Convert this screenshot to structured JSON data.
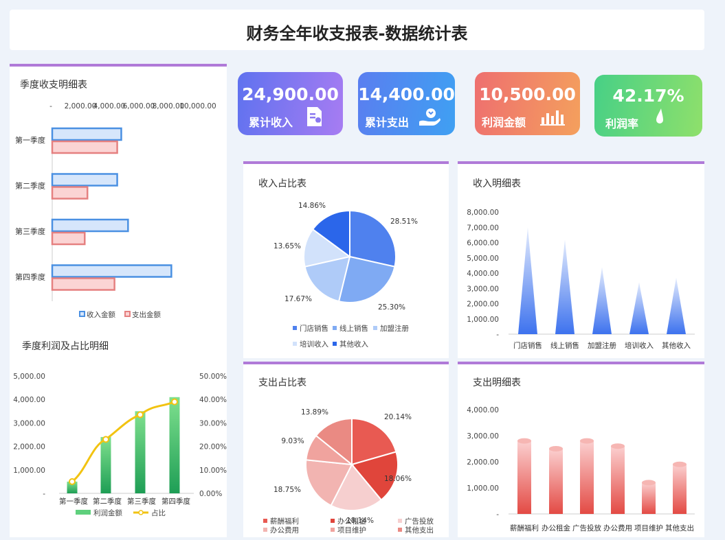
{
  "header": {
    "title": "财务全年收支报表-数据统计表"
  },
  "kpis": [
    {
      "value": "24,900.00",
      "label": "累计收入",
      "icon": "invoice-icon"
    },
    {
      "value": "14,400.00",
      "label": "累计支出",
      "icon": "hand-coin-icon"
    },
    {
      "value": "10,500.00",
      "label": "利润金额",
      "icon": "bar-chart-icon"
    },
    {
      "value": "42.17%",
      "label": "利润率",
      "icon": "drop-icon"
    }
  ],
  "colors": {
    "income": "#4a90e2",
    "income_fill": "#d6e6fb",
    "expense": "#e58080",
    "expense_fill": "#fbd4d4",
    "accent": "#b07ad8"
  },
  "chart_data": [
    {
      "id": "quarter",
      "type": "bar",
      "title": "季度收支明细表",
      "orientation": "horizontal",
      "categories": [
        "第一季度",
        "第二季度",
        "第三季度",
        "第四季度"
      ],
      "series": [
        {
          "name": "收入金额",
          "values": [
            5100,
            4800,
            5600,
            8800
          ]
        },
        {
          "name": "支出金额",
          "values": [
            4800,
            2600,
            2400,
            4600
          ]
        }
      ],
      "x_ticks": [
        "-",
        "2,000.00",
        "4,000.00",
        "6,000.00",
        "8,000.00",
        "10,000.00"
      ],
      "xlim": [
        0,
        10000
      ]
    },
    {
      "id": "profit",
      "type": "bar",
      "title": "季度利润及占比明细",
      "categories": [
        "第一季度",
        "第二季度",
        "第三季度",
        "第四季度"
      ],
      "series": [
        {
          "name": "利润金额",
          "values": [
            500,
            2400,
            3500,
            4100
          ],
          "axis": "left"
        },
        {
          "name": "占比",
          "type": "line",
          "values": [
            0.05,
            0.23,
            0.335,
            0.39
          ],
          "axis": "right"
        }
      ],
      "ylim": [
        0,
        5000
      ],
      "y_ticks": [
        "5,000.00",
        "4,000.00",
        "3,000.00",
        "2,000.00",
        "1,000.00",
        "-"
      ],
      "y2lim": [
        0,
        0.5
      ],
      "y2_ticks": [
        "50.00%",
        "40.00%",
        "30.00%",
        "20.00%",
        "10.00%",
        "0.00%"
      ]
    },
    {
      "id": "income_pie",
      "type": "pie",
      "title": "收入占比表",
      "labels": [
        "门店销售",
        "线上销售",
        "加盟注册",
        "培训收入",
        "其他收入"
      ],
      "values": [
        28.51,
        25.3,
        17.67,
        13.65,
        14.86
      ],
      "value_labels": [
        "28.51%",
        "25.30%",
        "17.67%",
        "13.65%",
        "14.86%"
      ],
      "colors": [
        "#4f81ee",
        "#7faaf3",
        "#afcbf8",
        "#d2e2fb",
        "#2b66ea"
      ]
    },
    {
      "id": "income_detail",
      "type": "bar",
      "title": "收入明细表",
      "categories": [
        "门店销售",
        "线上销售",
        "加盟注册",
        "培训收入",
        "其他收入"
      ],
      "values": [
        7000,
        6200,
        4400,
        3400,
        3700
      ],
      "ylim": [
        0,
        8000
      ],
      "y_ticks": [
        "8,000.00",
        "7,000.00",
        "6,000.00",
        "5,000.00",
        "4,000.00",
        "3,000.00",
        "2,000.00",
        "1,000.00",
        "-"
      ]
    },
    {
      "id": "expense_pie",
      "type": "pie",
      "title": "支出占比表",
      "labels": [
        "薪酬福利",
        "办公租金",
        "广告投放",
        "办公费用",
        "项目维护",
        "其他支出"
      ],
      "values": [
        20.14,
        18.06,
        18.14,
        18.75,
        9.03,
        13.89
      ],
      "value_labels": [
        "20.14%",
        "18.06%",
        "18.14%",
        "18.75%",
        "9.03%",
        "13.89%"
      ],
      "colors": [
        "#e85a52",
        "#e0453b",
        "#f6cfcf",
        "#f2b4b1",
        "#f0a39e",
        "#ea8a83"
      ]
    },
    {
      "id": "expense_detail",
      "type": "bar",
      "title": "支出明细表",
      "categories": [
        "薪酬福利",
        "办公租金",
        "广告投放",
        "办公费用",
        "项目维护",
        "其他支出"
      ],
      "values": [
        2800,
        2500,
        2800,
        2600,
        1200,
        1900
      ],
      "ylim": [
        0,
        4000
      ],
      "y_ticks": [
        "4,000.00",
        "3,000.00",
        "2,000.00",
        "1,000.00",
        "-"
      ]
    }
  ]
}
